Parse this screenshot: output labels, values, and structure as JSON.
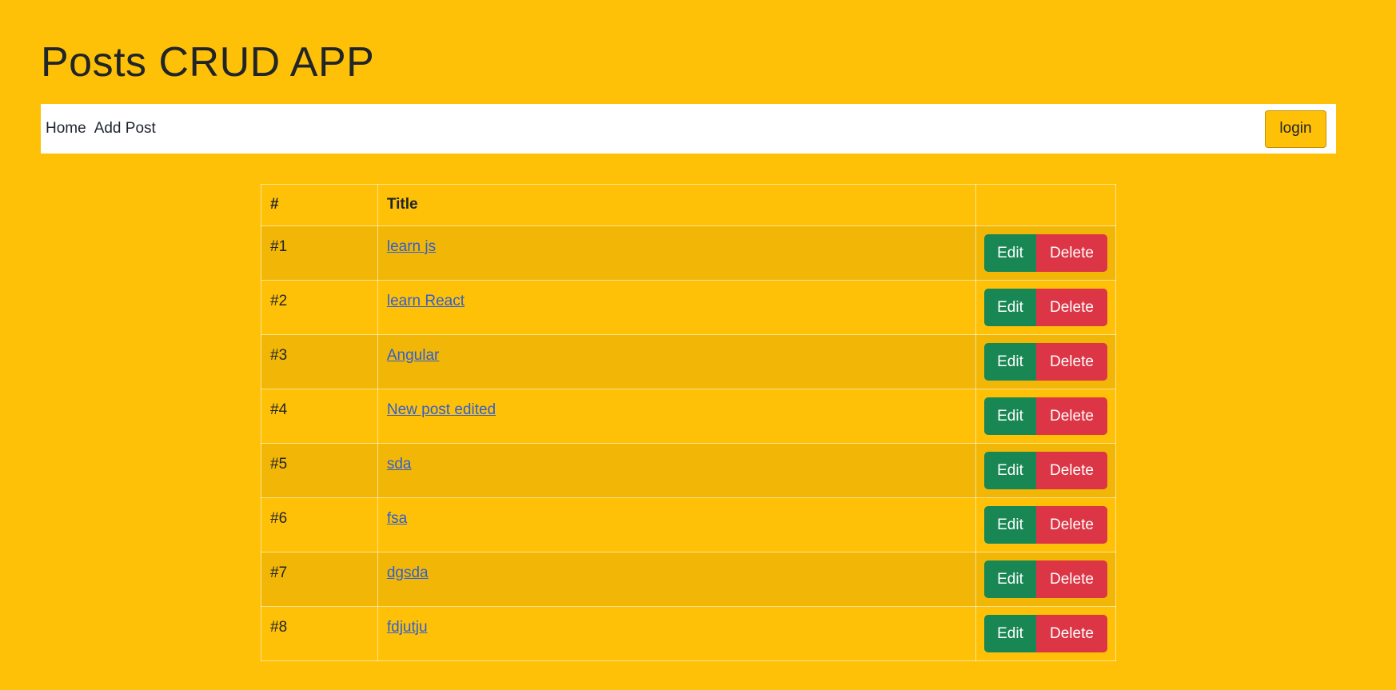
{
  "header": {
    "title": "Posts CRUD APP"
  },
  "navbar": {
    "links": [
      "Home",
      "Add Post"
    ],
    "login_label": "login"
  },
  "table": {
    "headers": [
      "#",
      "Title",
      ""
    ],
    "edit_label": "Edit",
    "delete_label": "Delete",
    "rows": [
      {
        "num": "#1",
        "title": "learn js"
      },
      {
        "num": "#2",
        "title": "learn React"
      },
      {
        "num": "#3",
        "title": "Angular"
      },
      {
        "num": "#4",
        "title": "New post edited"
      },
      {
        "num": "#5",
        "title": "sda"
      },
      {
        "num": "#6",
        "title": "fsa"
      },
      {
        "num": "#7",
        "title": "dgsda"
      },
      {
        "num": "#8",
        "title": "fdjutju"
      }
    ]
  },
  "colors": {
    "background": "#ffc107",
    "edit_button": "#198754",
    "delete_button": "#dc3545",
    "link": "#2f5fd0"
  }
}
